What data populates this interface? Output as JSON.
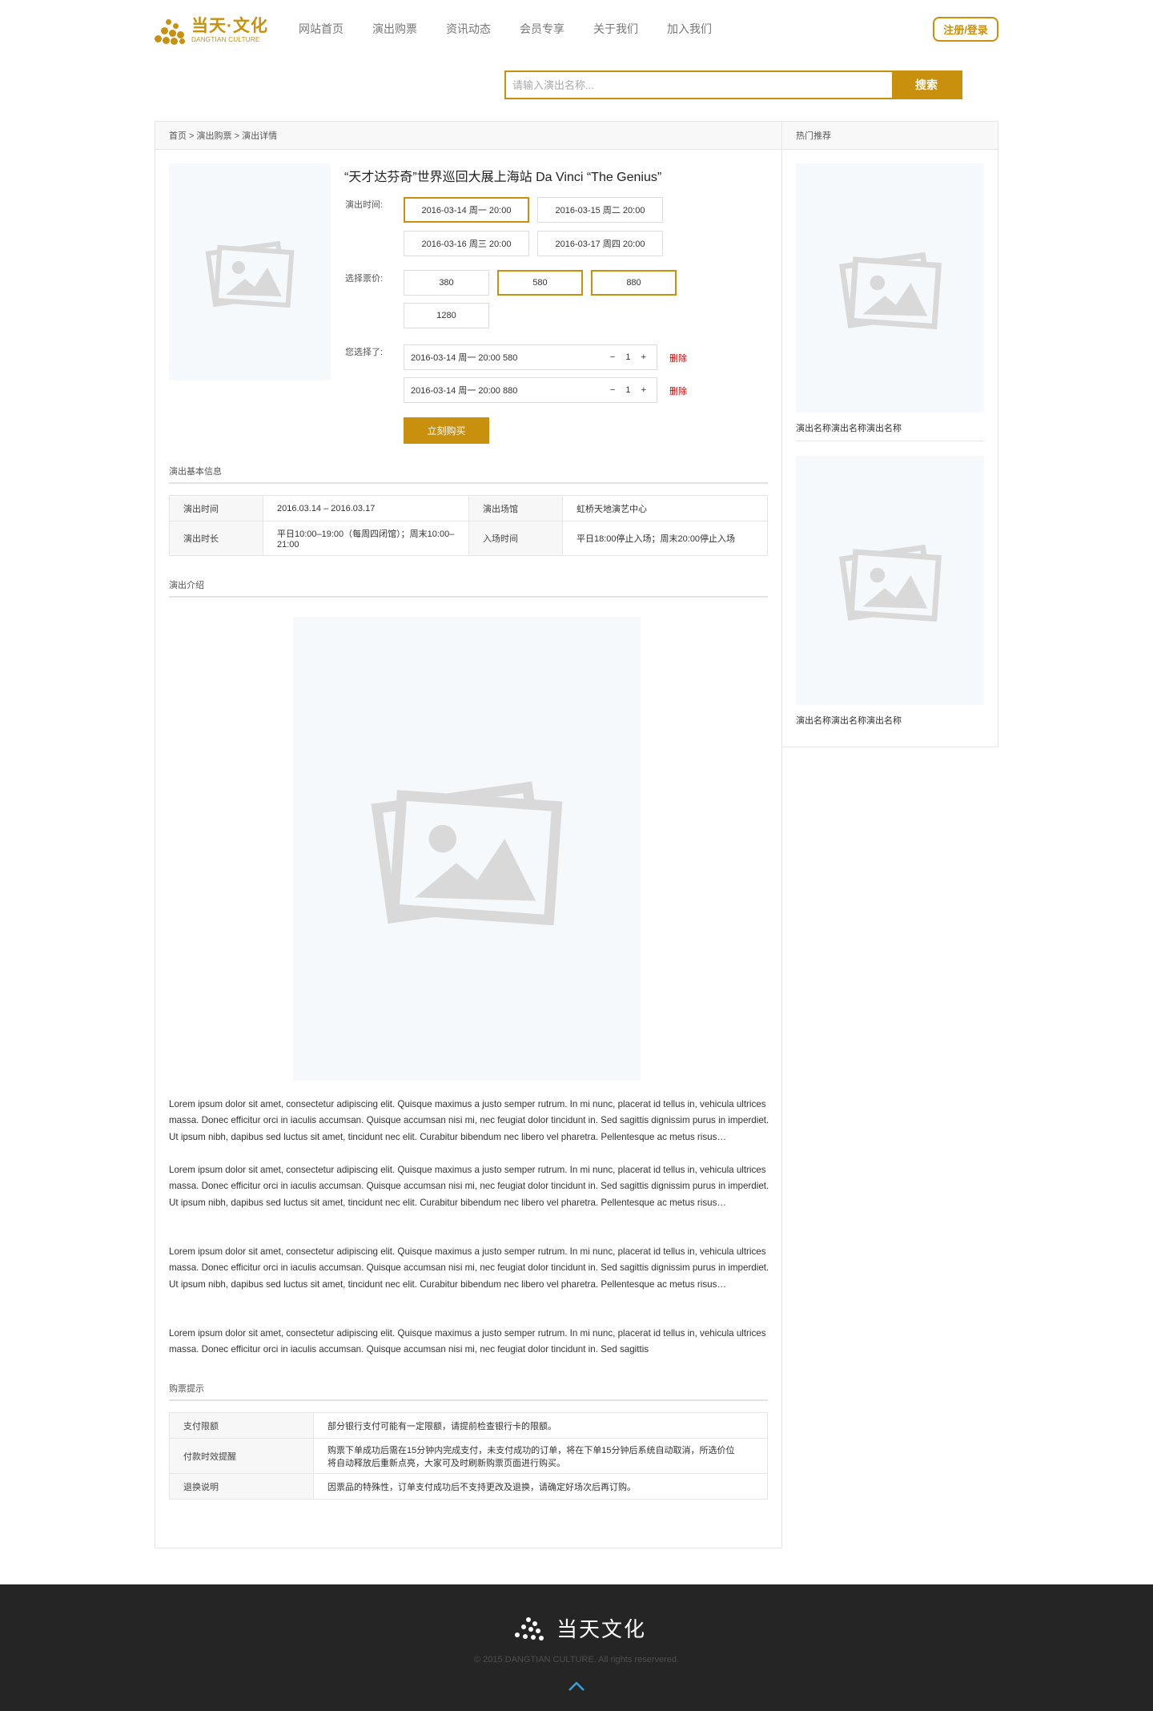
{
  "brand": {
    "name_cn": "当天·文化",
    "name_en": "DANGTIAN CULTURE",
    "accent": "#c8900d"
  },
  "nav": [
    "网站首页",
    "演出购票",
    "资讯动态",
    "会员专享",
    "关于我们",
    "加入我们"
  ],
  "login_label": "注册/登录",
  "search": {
    "placeholder": "请输入演出名称...",
    "button": "搜索"
  },
  "breadcrumb": "首页 > 演出购票 > 演出详情",
  "event": {
    "title": "“天才达芬奇”世界巡回大展上海站 Da Vinci “The Genius”",
    "time_label": "演出时间:",
    "times": [
      "2016-03-14 周一 20:00",
      "2016-03-15 周二 20:00",
      "2016-03-16 周三 20:00",
      "2016-03-17 周四 20:00"
    ],
    "price_label": "选择票价:",
    "prices": [
      "380",
      "580",
      "880",
      "1280"
    ],
    "chosen_label": "您选择了:",
    "chosen": [
      {
        "desc": "2016-03-14 周一 20:00   580",
        "qty": "− 1 +"
      },
      {
        "desc": "2016-03-14 周一 20:00   880",
        "qty": "− 1 +"
      }
    ],
    "delete_label": "删除",
    "buy_label": "立刻购买"
  },
  "basic_info": {
    "title": "演出基本信息",
    "rows": [
      [
        "演出时间",
        "2016.03.14 – 2016.03.17",
        "演出场馆",
        "虹桥天地演艺中心"
      ],
      [
        "演出时长",
        "平日10:00–19:00（每周四闭馆）；周末10:00–21:00",
        "入场时间",
        "平日18:00停止入场；周末20:00停止入场"
      ]
    ]
  },
  "intro": {
    "title": "演出介绍",
    "paragraphs": [
      "Lorem ipsum dolor sit amet, consectetur adipiscing elit. Quisque maximus a justo semper rutrum. In mi nunc, placerat id tellus in, vehicula ultrices massa. Donec efficitur orci in iaculis accumsan. Quisque accumsan nisi mi, nec feugiat dolor tincidunt in. Sed sagittis dignissim purus in imperdiet. Ut ipsum nibh, dapibus sed luctus sit amet, tincidunt nec elit. Curabitur bibendum nec libero vel pharetra. Pellentesque ac metus risus…",
      "Lorem ipsum dolor sit amet, consectetur adipiscing elit. Quisque maximus a justo semper rutrum. In mi nunc, placerat id tellus in, vehicula ultrices massa. Donec efficitur orci in iaculis accumsan. Quisque accumsan nisi mi, nec feugiat dolor tincidunt in. Sed sagittis dignissim purus in imperdiet. Ut ipsum nibh, dapibus sed luctus sit amet, tincidunt nec elit. Curabitur bibendum nec libero vel pharetra. Pellentesque ac metus risus…",
      "Lorem ipsum dolor sit amet, consectetur adipiscing elit. Quisque maximus a justo semper rutrum. In mi nunc, placerat id tellus in, vehicula ultrices massa. Donec efficitur orci in iaculis accumsan. Quisque accumsan nisi mi, nec feugiat dolor tincidunt in. Sed sagittis dignissim purus in imperdiet. Ut ipsum nibh, dapibus sed luctus sit amet, tincidunt nec elit. Curabitur bibendum nec libero vel pharetra. Pellentesque ac metus risus…",
      "Lorem ipsum dolor sit amet, consectetur adipiscing elit. Quisque maximus a justo semper rutrum. In mi nunc, placerat id tellus in, vehicula ultrices massa. Donec efficitur orci in iaculis accumsan. Quisque accumsan nisi mi, nec feugiat dolor tincidunt in. Sed sagittis"
    ]
  },
  "tips": {
    "title": "购票提示",
    "rows": [
      [
        "支付限额",
        "部分银行支付可能有一定限额，请提前检查银行卡的限额。"
      ],
      [
        "付款时效提醒",
        "购票下单成功后需在15分钟内完成支付，未支付成功的订单，将在下单15分钟后系统自动取消，所选价位将自动释放后重新点亮，大家可及时刷新购票页面进行购买。"
      ],
      [
        "退换说明",
        "因票品的特殊性，订单支付成功后不支持更改及退换，请确定好场次后再订购。"
      ]
    ]
  },
  "sidebar": {
    "title": "热门推荐",
    "items": [
      {
        "name": "演出名称演出名称演出名称"
      },
      {
        "name": "演出名称演出名称演出名称"
      }
    ]
  },
  "footer": {
    "logo_text": "当天文化",
    "copyright": "© 2015 DANGTIAN CULTURE. All rights reservered."
  }
}
